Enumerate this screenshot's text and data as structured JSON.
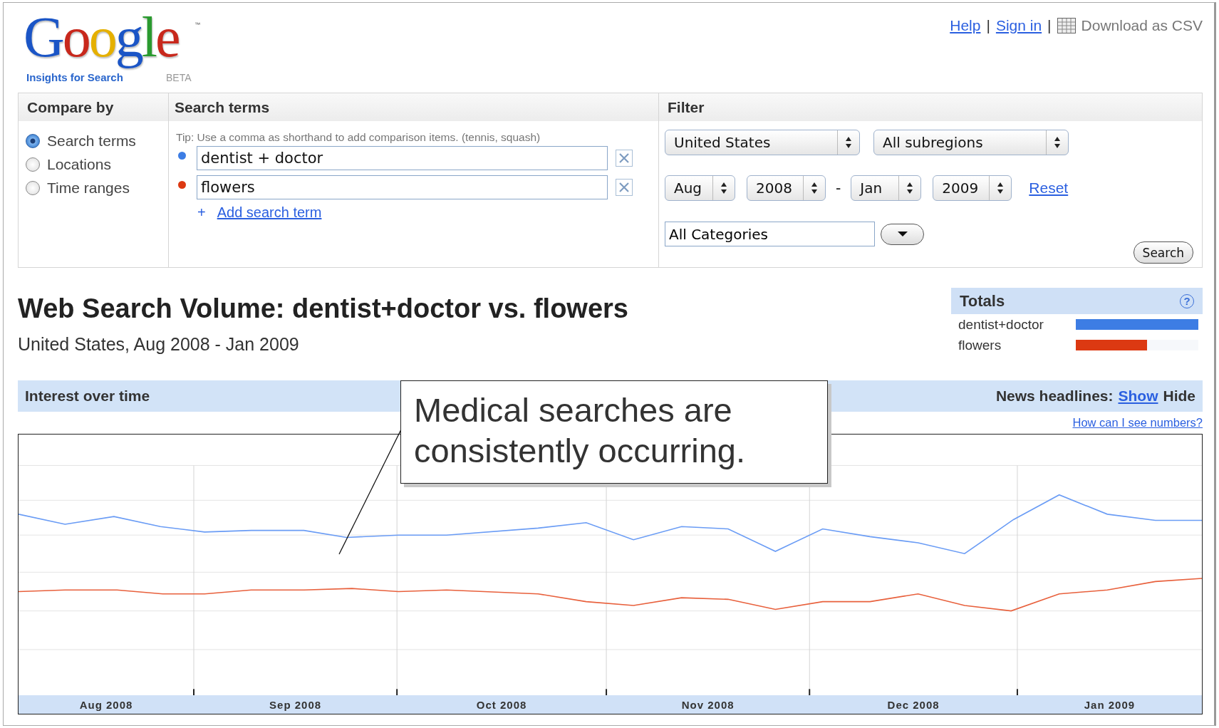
{
  "logo": {
    "wordmark": "Google",
    "tm": "™",
    "product": "Insights for Search",
    "badge": "BETA"
  },
  "top_links": [
    {
      "kind": "link",
      "label": "Help"
    },
    {
      "kind": "separator",
      "label": "|"
    },
    {
      "kind": "link",
      "label": "Sign in"
    },
    {
      "kind": "separator",
      "label": "|"
    },
    {
      "kind": "download",
      "label": "Download as CSV"
    }
  ],
  "panel": {
    "compare_by": {
      "heading": "Compare by",
      "options": [
        {
          "label": "Search terms",
          "selected": true
        },
        {
          "label": "Locations",
          "selected": false
        },
        {
          "label": "Time ranges",
          "selected": false
        }
      ]
    },
    "search_terms": {
      "heading": "Search terms",
      "tip": "Tip: Use a comma as shorthand to add comparison items. (tennis, squash)",
      "terms": [
        {
          "value": "dentist + doctor",
          "color": "#3d7de4"
        },
        {
          "value": "flowers",
          "color": "#dc3912"
        }
      ],
      "add_plus": "+",
      "add_link": "Add search term"
    },
    "filter": {
      "heading": "Filter",
      "location": "United States",
      "subregion": "All subregions",
      "from_month": "Aug",
      "from_year": "2008",
      "dash": "-",
      "to_month": "Jan",
      "to_year": "2009",
      "reset": "Reset",
      "category": "All Categories",
      "search_button": "Search"
    }
  },
  "title": "Web Search Volume: dentist+doctor vs. flowers",
  "subtitle": "United States, Aug 2008 - Jan 2009",
  "totals": {
    "heading": "Totals",
    "help": "?",
    "rows": [
      {
        "label": "dentist+doctor",
        "color": "#3d7de4",
        "level": 1.0
      },
      {
        "label": "flowers",
        "color": "#dc3912",
        "level": 0.58
      }
    ]
  },
  "interest_bar": {
    "heading": "Interest over time",
    "news_label": "News headlines:",
    "show": "Show",
    "hide": "Hide"
  },
  "numbers_link": "How can I see numbers?",
  "chart": {
    "x_labels": [
      "Aug 2008",
      "Sep 2008",
      "Oct 2008",
      "Nov 2008",
      "Dec 2008",
      "Jan 2009"
    ]
  },
  "callout": "Medical searches are consistently occurring."
}
